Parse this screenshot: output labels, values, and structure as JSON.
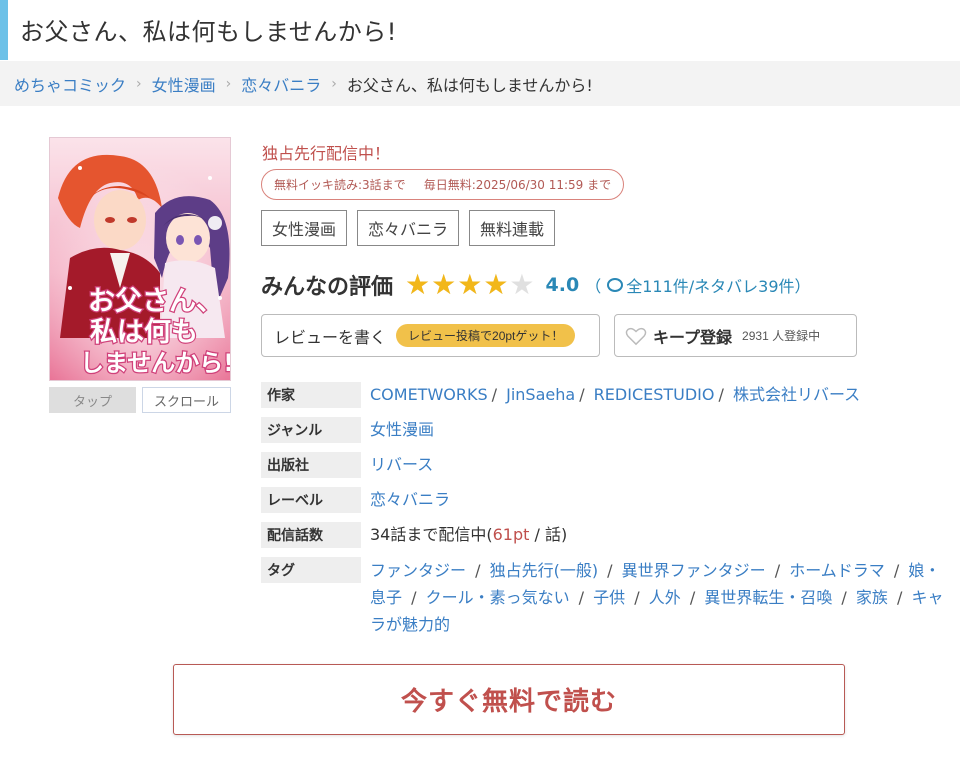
{
  "page": {
    "title": "お父さん、私は何もしませんから!"
  },
  "breadcrumb": {
    "items": [
      "めちゃコミック",
      "女性漫画",
      "恋々バニラ"
    ],
    "current": "お父さん、私は何もしませんから!",
    "separator": "›"
  },
  "cover": {
    "title_lines": [
      "お父さん、",
      "私は何も",
      "しませんから!"
    ],
    "view_tabs": [
      "タップ",
      "スクロール"
    ]
  },
  "status": {
    "exclusive": "独占先行配信中！",
    "free_read": "無料イッキ読み:3話まで",
    "daily_free": "毎日無料:2025/06/30 11:59 まで"
  },
  "genre_chips": [
    "女性漫画",
    "恋々バニラ",
    "無料連載"
  ],
  "rating": {
    "heading": "みんなの評価",
    "score": "4.0",
    "score_value": 4.0,
    "max": 5,
    "paren_open": "（",
    "total": "全111件",
    "spoilers": "/ネタバレ39件",
    "paren_close": "）"
  },
  "actions": {
    "review_label": "レビューを書く",
    "review_reward": "レビュー投稿で20ptゲット！",
    "keep_label": "キープ登録",
    "keep_count": "2931 人登録中"
  },
  "info": {
    "author_label": "作家",
    "authors": [
      "COMETWORKS",
      "JinSaeha",
      "REDICESTUDIO",
      "株式会社リバース"
    ],
    "genre_label": "ジャンル",
    "genre": "女性漫画",
    "publisher_label": "出版社",
    "publisher": "リバース",
    "label_label": "レーベル",
    "label": "恋々バニラ",
    "episodes_label": "配信話数",
    "episodes_prefix": "34話まで配信中(",
    "price": "61pt",
    "episodes_suffix": " / 話)",
    "tags_label": "タグ",
    "tags": [
      "ファンタジー",
      "独占先行(一般)",
      "異世界ファンタジー",
      "ホームドラマ",
      "娘・息子",
      "クール・素っ気ない",
      "子供",
      "人外",
      "異世界転生・召喚",
      "家族",
      "キャラが魅力的"
    ]
  },
  "cta": {
    "label": "今すぐ無料で読む"
  },
  "colors": {
    "accent_blue": "#6cc1e8",
    "link": "#3a7ec4",
    "red": "#c0504d",
    "star": "#f2b71a",
    "score_blue": "#2a88b6"
  }
}
